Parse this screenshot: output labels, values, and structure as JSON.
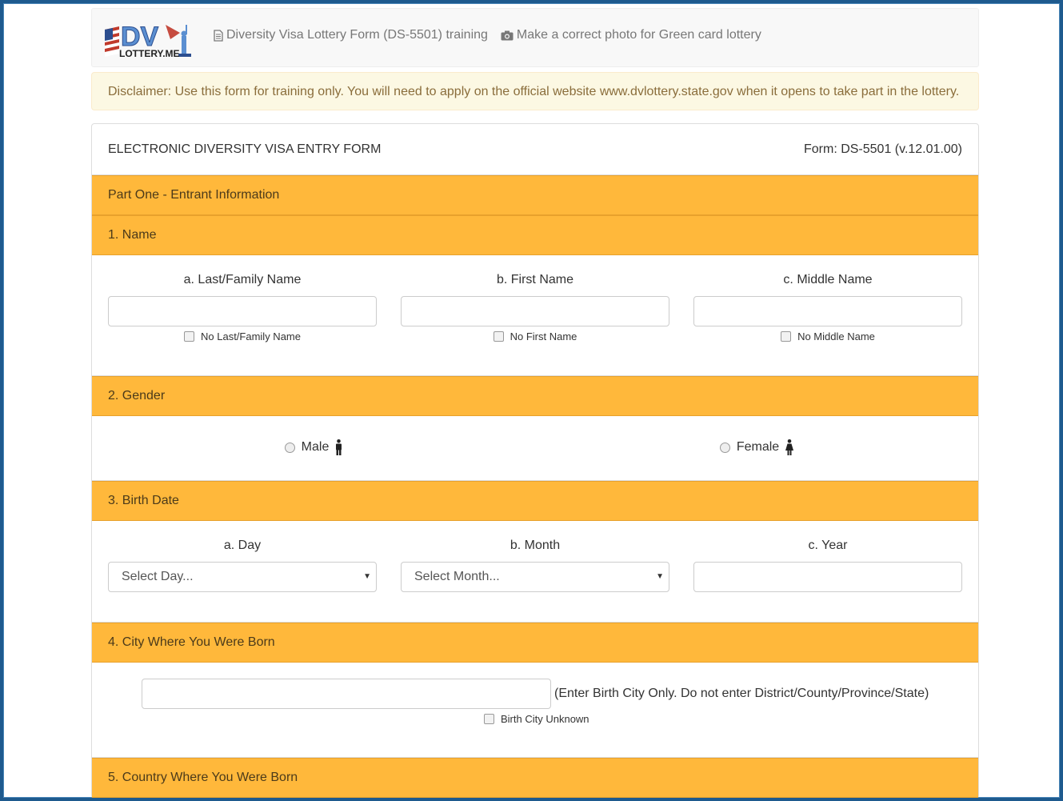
{
  "nav": {
    "logo_text": "DV LOTTERY.ME",
    "links": [
      {
        "icon": "document-icon",
        "label": "Diversity Visa Lottery Form (DS-5501) training"
      },
      {
        "icon": "camera-icon",
        "label": "Make a correct photo for Green card lottery"
      }
    ]
  },
  "alert": {
    "text": "Disclaimer: Use this form for training only. You will need to apply on the official website www.dvlottery.state.gov when it opens to take part in the lottery."
  },
  "form": {
    "title": "ELECTRONIC DIVERSITY VISA ENTRY FORM",
    "form_id": "Form: DS-5501 (v.12.01.00)"
  },
  "part_one": {
    "title": "Part One - Entrant Information"
  },
  "name": {
    "title": "1. Name",
    "fields": [
      {
        "label": "a. Last/Family Name",
        "value": "",
        "checkbox": "No Last/Family Name"
      },
      {
        "label": "b. First Name",
        "value": "",
        "checkbox": "No First Name"
      },
      {
        "label": "c. Middle Name",
        "value": "",
        "checkbox": "No Middle Name"
      }
    ]
  },
  "gender": {
    "title": "2. Gender",
    "options": [
      {
        "label": "Male",
        "icon": "male-icon"
      },
      {
        "label": "Female",
        "icon": "female-icon"
      }
    ]
  },
  "birth_date": {
    "title": "3. Birth Date",
    "day": {
      "label": "a. Day",
      "selected": "Select Day..."
    },
    "month": {
      "label": "b. Month",
      "selected": "Select Month..."
    },
    "year": {
      "label": "c. Year",
      "value": ""
    }
  },
  "birth_city": {
    "title": "4. City Where You Were Born",
    "value": "",
    "hint": "(Enter Birth City Only. Do not enter District/County/Province/State)",
    "checkbox": "Birth City Unknown"
  },
  "birth_country": {
    "title": "5. Country Where You Were Born"
  },
  "colors": {
    "section_header": "#ffb83b",
    "alert_bg": "#fcf8e3",
    "alert_text": "#8a6d3b",
    "page_border": "#1e5a8e"
  }
}
